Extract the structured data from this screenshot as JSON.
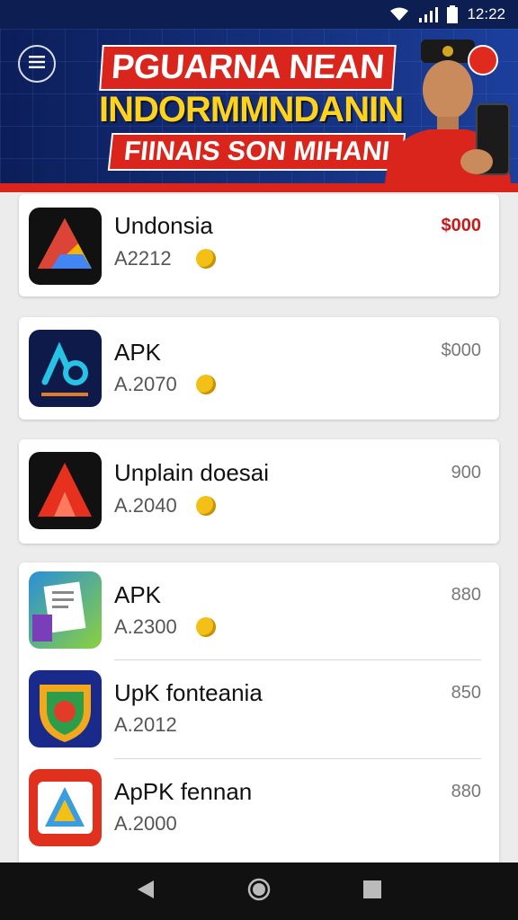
{
  "status": {
    "time": "12:22",
    "icons": [
      "wifi-icon",
      "signal-icon",
      "battery-icon"
    ]
  },
  "banner": {
    "line1": "PGUARNA NEAN",
    "line2": "INDORMMNDANIN",
    "line3": "FIINAIS SON MIHANI",
    "menu_icon": "menu-icon"
  },
  "apps": [
    {
      "name": "Undonsia",
      "code": "A2212",
      "price": "$000",
      "icon": "triangle-logo-icon",
      "accent": true
    },
    {
      "name": "APK",
      "code": "A.2070",
      "price": "$000",
      "icon": "ab-logo-icon",
      "accent": false
    },
    {
      "name": "Unplain doesai",
      "code": "A.2040",
      "price": "900",
      "icon": "a-logo-icon",
      "accent": false
    },
    {
      "name": "APK",
      "code": "A.2300",
      "price": "880",
      "icon": "documents-icon",
      "accent": false
    },
    {
      "name": "UpK fonteania",
      "code": "A.2012",
      "price": "850",
      "icon": "shield-icon",
      "accent": false
    },
    {
      "name": "ApPK fennan",
      "code": "A.2000",
      "price": "880",
      "icon": "arrow-logo-icon",
      "accent": false
    }
  ],
  "colors": {
    "accent_red": "#d9251c",
    "banner_blue": "#0c1e5a",
    "coin": "#f2c016",
    "price_accent": "#c51c1c"
  },
  "nav": {
    "icons": [
      "back-icon",
      "home-icon",
      "recents-icon"
    ]
  }
}
